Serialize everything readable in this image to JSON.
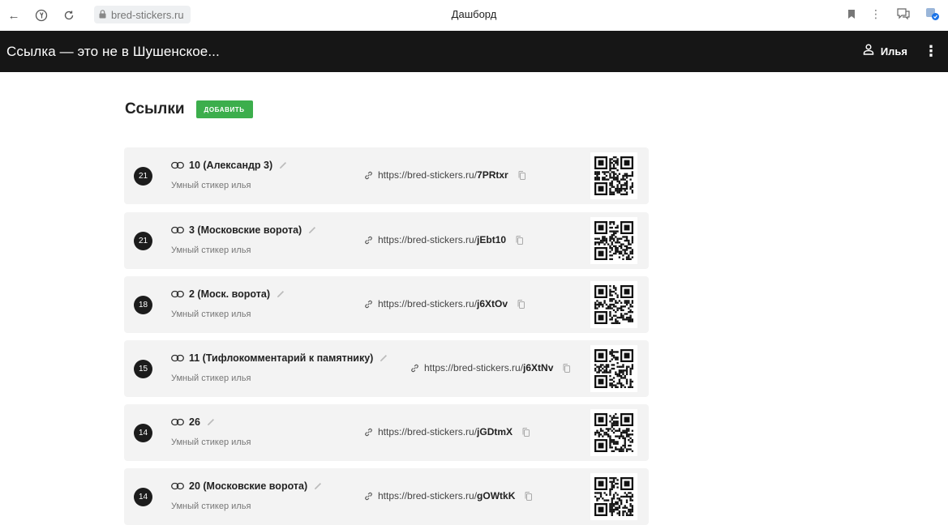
{
  "browser": {
    "url": "bred-stickers.ru",
    "title": "Дашборд"
  },
  "app": {
    "title": "Ссылка — это не в Шушенское...",
    "user": "Илья"
  },
  "page": {
    "title": "Ссылки",
    "add_label": "ДОБАВИТЬ"
  },
  "links": [
    {
      "count": "21",
      "name": "10 (Александр 3)",
      "subtitle": "Умный стикер илья",
      "url_prefix": "https://bred-stickers.ru/",
      "code": "7PRtxr"
    },
    {
      "count": "21",
      "name": "3 (Московские ворота)",
      "subtitle": "Умный стикер илья",
      "url_prefix": "https://bred-stickers.ru/",
      "code": "jEbt10"
    },
    {
      "count": "18",
      "name": "2 (Моск. ворота)",
      "subtitle": "Умный стикер илья",
      "url_prefix": "https://bred-stickers.ru/",
      "code": "j6XtOv"
    },
    {
      "count": "15",
      "name": "11 (Тифлокомментарий к памятнику)",
      "subtitle": "Умный стикер илья",
      "url_prefix": "https://bred-stickers.ru/",
      "code": "j6XtNv"
    },
    {
      "count": "14",
      "name": "26",
      "subtitle": "Умный стикер илья",
      "url_prefix": "https://bred-stickers.ru/",
      "code": "jGDtmX"
    },
    {
      "count": "14",
      "name": "20 (Московские ворота)",
      "subtitle": "Умный стикер илья",
      "url_prefix": "https://bred-stickers.ru/",
      "code": "gOWtkK"
    }
  ]
}
